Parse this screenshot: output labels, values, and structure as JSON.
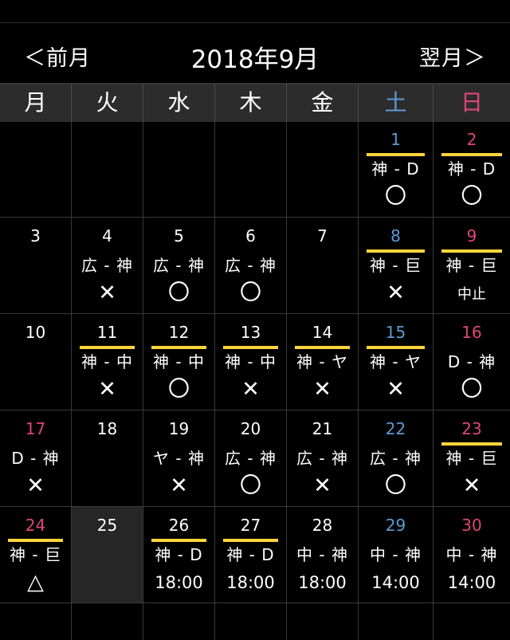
{
  "nav": {
    "prev_label": "＜前月",
    "title": "2018年9月",
    "next_label": "翌月＞"
  },
  "colors": {
    "saturday": "#5b9bd5",
    "sunday": "#e0457b",
    "game_bar": "#ffd53c"
  },
  "weekdays": [
    {
      "label": "月",
      "type": "weekday"
    },
    {
      "label": "火",
      "type": "weekday"
    },
    {
      "label": "水",
      "type": "weekday"
    },
    {
      "label": "木",
      "type": "weekday"
    },
    {
      "label": "金",
      "type": "weekday"
    },
    {
      "label": "土",
      "type": "sat"
    },
    {
      "label": "日",
      "type": "sun"
    }
  ],
  "weeks": [
    [
      {
        "day": ""
      },
      {
        "day": ""
      },
      {
        "day": ""
      },
      {
        "day": ""
      },
      {
        "day": ""
      },
      {
        "day": "1",
        "type": "sat",
        "bar": true,
        "match": "神 - D",
        "result": "〇"
      },
      {
        "day": "2",
        "type": "sun",
        "bar": true,
        "match": "神 - D",
        "result": "〇"
      }
    ],
    [
      {
        "day": "3"
      },
      {
        "day": "4",
        "match": "広 - 神",
        "result": "✕"
      },
      {
        "day": "5",
        "match": "広 - 神",
        "result": "〇"
      },
      {
        "day": "6",
        "match": "広 - 神",
        "result": "〇"
      },
      {
        "day": "7"
      },
      {
        "day": "8",
        "type": "sat",
        "bar": true,
        "match": "神 - 巨",
        "result": "✕"
      },
      {
        "day": "9",
        "type": "sun",
        "bar": true,
        "match": "神 - 巨",
        "result": "中止",
        "result_style": "small"
      }
    ],
    [
      {
        "day": "10"
      },
      {
        "day": "11",
        "bar": true,
        "match": "神 - 中",
        "result": "✕"
      },
      {
        "day": "12",
        "bar": true,
        "match": "神 - 中",
        "result": "〇"
      },
      {
        "day": "13",
        "bar": true,
        "match": "神 - 中",
        "result": "✕"
      },
      {
        "day": "14",
        "bar": true,
        "match": "神 - ヤ",
        "result": "✕"
      },
      {
        "day": "15",
        "type": "sat",
        "bar": true,
        "match": "神 - ヤ",
        "result": "✕"
      },
      {
        "day": "16",
        "type": "sun",
        "match": "D - 神",
        "result": "〇"
      }
    ],
    [
      {
        "day": "17",
        "type": "sun",
        "match": "D - 神",
        "result": "✕"
      },
      {
        "day": "18"
      },
      {
        "day": "19",
        "match": "ヤ - 神",
        "result": "✕"
      },
      {
        "day": "20",
        "match": "広 - 神",
        "result": "〇"
      },
      {
        "day": "21",
        "match": "広 - 神",
        "result": "✕"
      },
      {
        "day": "22",
        "type": "sat",
        "match": "広 - 神",
        "result": "〇"
      },
      {
        "day": "23",
        "type": "sun",
        "bar": true,
        "match": "神 - 巨",
        "result": "✕"
      }
    ],
    [
      {
        "day": "24",
        "type": "sun",
        "bar": true,
        "match": "神 - 巨",
        "result": "△"
      },
      {
        "day": "25",
        "today": true
      },
      {
        "day": "26",
        "bar": true,
        "match": "神 - D",
        "result": "18:00",
        "result_style": "time"
      },
      {
        "day": "27",
        "bar": true,
        "match": "神 - D",
        "result": "18:00",
        "result_style": "time"
      },
      {
        "day": "28",
        "match": "中 - 神",
        "result": "18:00",
        "result_style": "time"
      },
      {
        "day": "29",
        "type": "sat",
        "match": "中 - 神",
        "result": "14:00",
        "result_style": "time"
      },
      {
        "day": "30",
        "type": "sun",
        "match": "中 - 神",
        "result": "14:00",
        "result_style": "time"
      }
    ],
    [
      {
        "day": ""
      },
      {
        "day": ""
      },
      {
        "day": ""
      },
      {
        "day": ""
      },
      {
        "day": ""
      },
      {
        "day": ""
      },
      {
        "day": ""
      }
    ]
  ]
}
